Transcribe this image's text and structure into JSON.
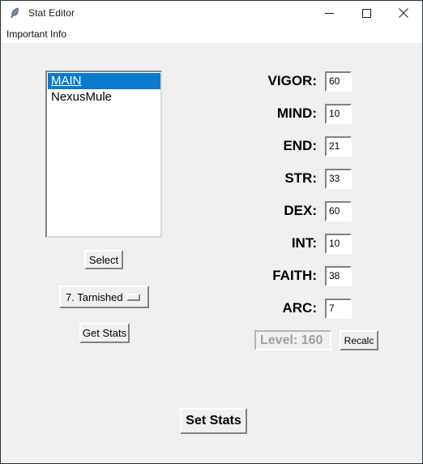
{
  "window": {
    "title": "Stat Editor",
    "icon": "feather-icon",
    "background_color": "#f0f0f0",
    "controls": [
      {
        "name": "minimize",
        "glyph": "minimize-icon"
      },
      {
        "name": "maximize",
        "glyph": "maximize-icon"
      },
      {
        "name": "close",
        "glyph": "close-icon"
      }
    ]
  },
  "menubar": {
    "items": [
      {
        "label": "Important Info"
      }
    ]
  },
  "character_list": {
    "items": [
      {
        "label": "MAIN",
        "selected": true
      },
      {
        "label": "NexusMule",
        "selected": false
      }
    ],
    "selection_color": "#0a7ad0",
    "selection_text_color": "#ffffff"
  },
  "controls": {
    "select_label": "Select",
    "get_stats_label": "Get Stats",
    "set_stats_label": "Set Stats",
    "recalc_label": "Recalc"
  },
  "class_menu": {
    "selected": "7. Tarnished",
    "indicator": "option-menu-indicator"
  },
  "stats": [
    {
      "label": "VIGOR:",
      "value": "60"
    },
    {
      "label": "MIND:",
      "value": "10"
    },
    {
      "label": "END:",
      "value": "21"
    },
    {
      "label": "STR:",
      "value": "33"
    },
    {
      "label": "DEX:",
      "value": "60"
    },
    {
      "label": "INT:",
      "value": "10"
    },
    {
      "label": "FAITH:",
      "value": "38"
    },
    {
      "label": "ARC:",
      "value": "7"
    }
  ],
  "level": {
    "text": "Level: 160",
    "disabled_text_color": "#a0a0a0"
  }
}
